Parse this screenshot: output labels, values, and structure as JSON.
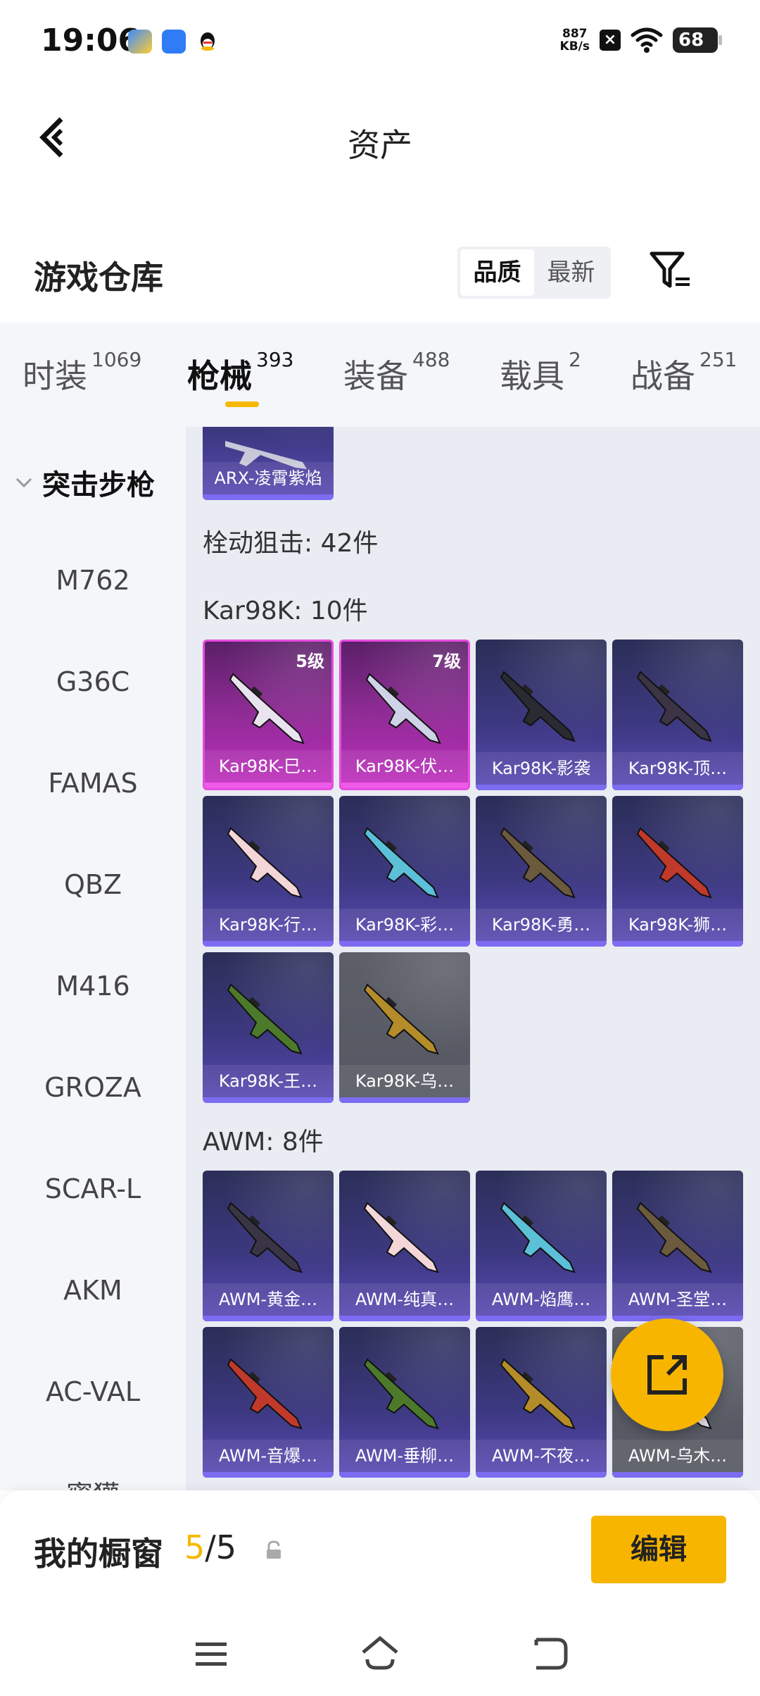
{
  "status_bar": {
    "time": "19:06",
    "speed_value": "887",
    "speed_unit": "KB/s",
    "battery": "68"
  },
  "header": {
    "title": "资产"
  },
  "warehouse": {
    "title": "游戏仓库",
    "sort_options": [
      "品质",
      "最新"
    ],
    "sort_selected": "品质"
  },
  "tabs": [
    {
      "label": "时装",
      "count": "1069"
    },
    {
      "label": "枪械",
      "count": "393"
    },
    {
      "label": "装备",
      "count": "488"
    },
    {
      "label": "载具",
      "count": "2"
    },
    {
      "label": "战备",
      "count": "251"
    }
  ],
  "active_tab": "枪械",
  "sidebar": {
    "group": "突击步枪",
    "items": [
      "M762",
      "G36C",
      "FAMAS",
      "QBZ",
      "M416",
      "GROZA",
      "SCAR-L",
      "AKM",
      "AC-VAL",
      "蜜獾"
    ]
  },
  "content": {
    "top_card": "ARX-凌霄紫焰",
    "category_label": "栓动狙击: 42件",
    "groups": [
      {
        "label": "Kar98K: 10件",
        "items": [
          {
            "name": "Kar98K-巳…",
            "level": "5级",
            "rarity": "legend"
          },
          {
            "name": "Kar98K-伏…",
            "level": "7级",
            "rarity": "legend"
          },
          {
            "name": "Kar98K-影袭",
            "rarity": "epic"
          },
          {
            "name": "Kar98K-顶…",
            "rarity": "epic"
          },
          {
            "name": "Kar98K-行…",
            "rarity": "epic"
          },
          {
            "name": "Kar98K-彩…",
            "rarity": "epic"
          },
          {
            "name": "Kar98K-勇…",
            "rarity": "epic"
          },
          {
            "name": "Kar98K-狮…",
            "rarity": "epic"
          },
          {
            "name": "Kar98K-王…",
            "rarity": "epic"
          },
          {
            "name": "Kar98K-乌…",
            "rarity": "grey"
          }
        ]
      },
      {
        "label": "AWM: 8件",
        "items": [
          {
            "name": "AWM-黄金…",
            "rarity": "epic"
          },
          {
            "name": "AWM-纯真…",
            "rarity": "epic"
          },
          {
            "name": "AWM-焰鹰…",
            "rarity": "epic"
          },
          {
            "name": "AWM-圣堂…",
            "rarity": "epic"
          },
          {
            "name": "AWM-音爆…",
            "rarity": "epic"
          },
          {
            "name": "AWM-垂柳…",
            "rarity": "epic"
          },
          {
            "name": "AWM-不夜…",
            "rarity": "epic"
          },
          {
            "name": "AWM-乌木…",
            "rarity": "grey"
          }
        ]
      }
    ]
  },
  "showcase": {
    "label": "我的橱窗",
    "current": "5",
    "separator": "/",
    "total": "5",
    "edit_label": "编辑"
  },
  "colors": {
    "accent": "#f7b500",
    "epic": "#5a4bb7",
    "legend": "#c12fbf",
    "panel": "#f4f6fa"
  }
}
